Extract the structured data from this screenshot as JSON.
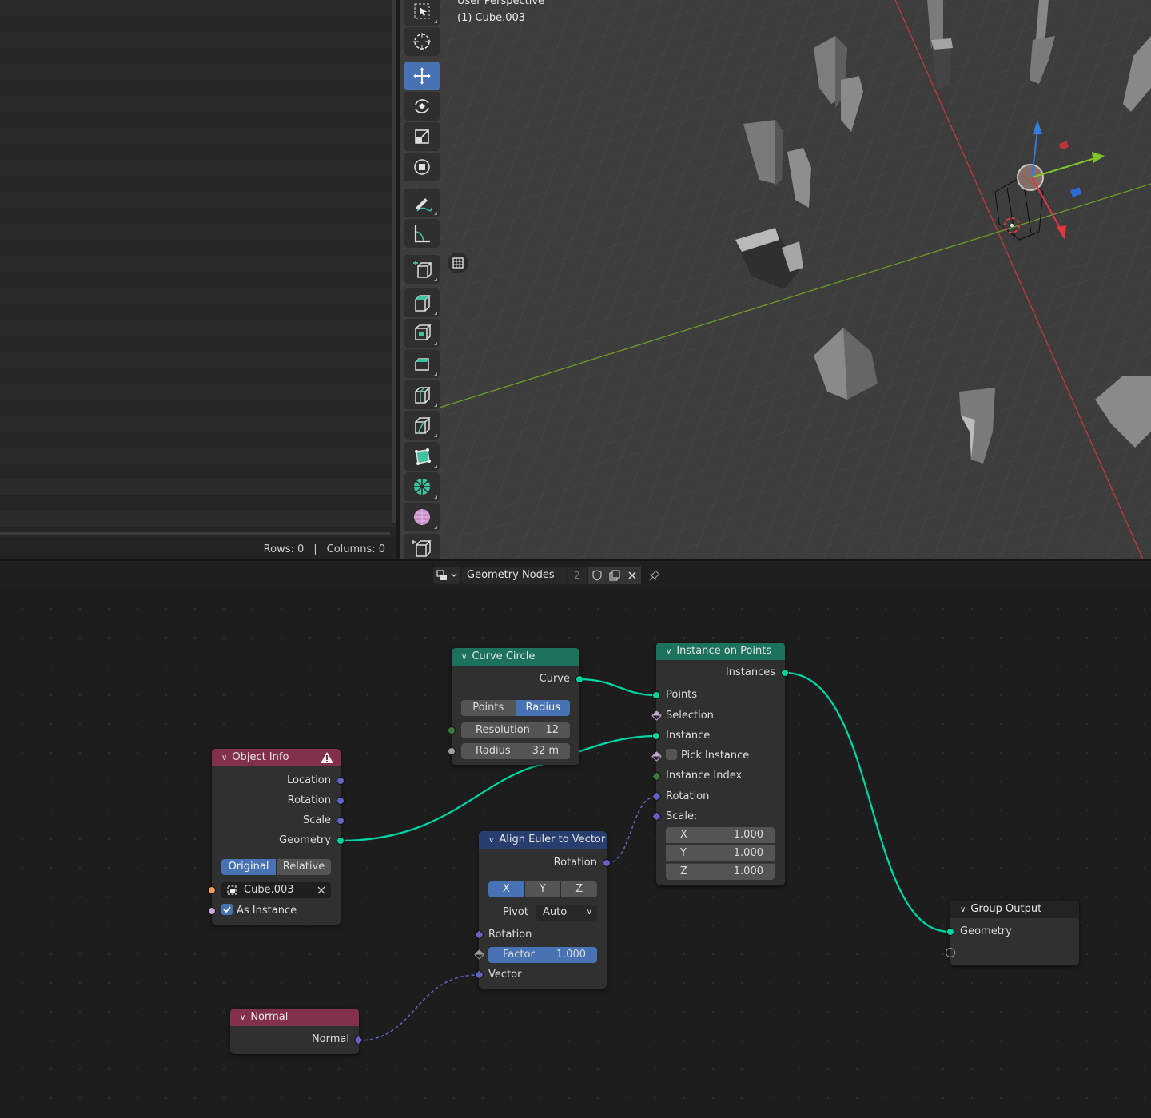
{
  "spreadsheet": {
    "rows_label": "Rows: 0",
    "separator": "|",
    "columns_label": "Columns: 0"
  },
  "viewport": {
    "mode_text": "User Perspective",
    "object_text": "(1) Cube.003",
    "tools": [
      "select-box-icon",
      "cursor-icon",
      "move-icon",
      "rotate-icon",
      "scale-icon",
      "transform-icon",
      "annotate-icon",
      "measure-icon",
      "add-cube-icon",
      "extrude-icon",
      "inset-icon",
      "bevel-icon",
      "loop-cut-icon",
      "knife-icon",
      "poly-build-icon",
      "spin-icon",
      "smooth-icon",
      "shear-icon"
    ],
    "active_tool": "move-icon",
    "colors": {
      "grid_bg": "#3d3d3d",
      "x_axis": "#c3383c",
      "y_axis": "#6d9c25",
      "active_tool": "#4772b3"
    }
  },
  "node_header": {
    "tree_name": "Geometry Nodes",
    "user_count": "2"
  },
  "nodes": {
    "object_info": {
      "title": "Object Info",
      "outputs": [
        "Location",
        "Rotation",
        "Scale",
        "Geometry"
      ],
      "mode_options": [
        "Original",
        "Relative"
      ],
      "mode_selected": "Original",
      "object_value": "Cube.003",
      "as_instance_label": "As Instance",
      "as_instance_checked": true
    },
    "curve_circle": {
      "title": "Curve Circle",
      "output": "Curve",
      "mode_options": [
        "Points",
        "Radius"
      ],
      "mode_selected": "Radius",
      "resolution_label": "Resolution",
      "resolution_value": "12",
      "radius_label": "Radius",
      "radius_value": "32 m"
    },
    "instance_on_points": {
      "title": "Instance on Points",
      "output": "Instances",
      "inputs": [
        "Points",
        "Selection",
        "Instance",
        "Pick Instance",
        "Instance Index",
        "Rotation",
        "Scale:"
      ],
      "scale": [
        {
          "axis": "X",
          "value": "1.000"
        },
        {
          "axis": "Y",
          "value": "1.000"
        },
        {
          "axis": "Z",
          "value": "1.000"
        }
      ]
    },
    "align_euler": {
      "title": "Align Euler to Vector",
      "output": "Rotation",
      "axis_options": [
        "X",
        "Y",
        "Z"
      ],
      "axis_selected": "X",
      "pivot_label": "Pivot",
      "pivot_value": "Auto",
      "rotation_label": "Rotation",
      "factor_label": "Factor",
      "factor_value": "1.000",
      "vector_label": "Vector"
    },
    "normal": {
      "title": "Normal",
      "output": "Normal"
    },
    "group_output": {
      "title": "Group Output",
      "input": "Geometry"
    }
  },
  "colors": {
    "geometry_socket": "#00d6a3",
    "vector_socket": "#6363c7",
    "input_header": "#83314a",
    "geometry_header": "#1d725e",
    "vector_header": "#273e6e"
  }
}
